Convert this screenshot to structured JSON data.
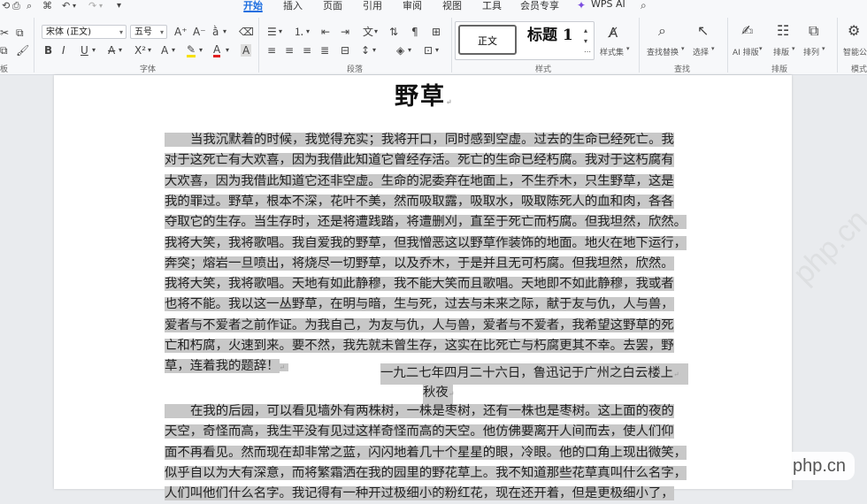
{
  "menu": {
    "tabs": [
      "开始",
      "插入",
      "页面",
      "引用",
      "审阅",
      "视图",
      "工具",
      "会员专享"
    ],
    "wps_ai": "WPS AI"
  },
  "font": {
    "family": "宋体 (正文)",
    "size": "五号",
    "group_label": "字体"
  },
  "paragraph": {
    "group_label": "段落"
  },
  "styles": {
    "normal": "正文",
    "heading1": "标题 1",
    "styleset": "样式集",
    "group_label": "样式"
  },
  "find": {
    "find_replace": "查找替换",
    "select": "选择",
    "group_label": "查找"
  },
  "arrange": {
    "ai_layout": "AI 排版",
    "layout": "排版",
    "arrange": "排列",
    "group_label": "排版"
  },
  "smart": {
    "smart_label": "智能公",
    "group_label": "模式"
  },
  "left_edge": {
    "board_label": "板"
  },
  "doc": {
    "title": "野草",
    "para1_lines": [
      "当我沉默着的时候，我觉得充实；我将开口，同时感到空虚。过去的生命已经死亡。我",
      "对于这死亡有大欢喜，因为我借此知道它曾经存活。死亡的生命已经朽腐。我对于这朽腐有",
      "大欢喜，因为我借此知道它还非空虚。生命的泥委弃在地面上，不生乔木，只生野草，这是",
      "我的罪过。野草，根本不深，花叶不美，然而吸取露，吸取水，吸取陈死人的血和肉，各各",
      "夺取它的生存。当生存时，还是将遭践踏，将遭删刈，直至于死亡而朽腐。但我坦然，欣然。",
      "我将大笑，我将歌唱。我自爱我的野草，但我憎恶这以野草作装饰的地面。地火在地下运行，",
      "奔突；熔岩一旦喷出，将烧尽一切野草，以及乔木，于是并且无可朽腐。但我坦然，欣然。",
      "我将大笑，我将歌唱。天地有如此静穆，我不能大笑而且歌唱。天地即不如此静穆，我或者",
      "也将不能。我以这一丛野草，在明与暗，生与死，过去与未来之际，献于友与仇，人与兽，",
      "爱者与不爱者之前作证。为我自己，为友与仇，人与兽，爱者与不爱者，我希望这野草的死",
      "亡和朽腐，火速到来。要不然，我先就未曾生存，这实在比死亡与朽腐更其不幸。去罢，野",
      "草，连着我的题辞！"
    ],
    "signature": "一九二七年四月二十六日，鲁迅记于广州之白云楼上",
    "subtitle": "秋夜",
    "para2_lines": [
      "在我的后园，可以看见墙外有两株树，一株是枣树，还有一株也是枣树。这上面的夜的",
      "天空，奇怪而高，我生平没有见过这样奇怪而高的天空。他仿佛要离开人间而去，使人们仰",
      "面不再看见。然而现在却非常之蓝，闪闪地着几十个星星的眼，冷眼。他的口角上现出微笑，",
      "似乎自以为大有深意，而将繁霜洒在我的园里的野花草上。我不知道那些花草真叫什么名字，",
      "人们叫他们什么名字。我记得有一种开过极细小的粉红花，现在还开着，但是更极细小了，"
    ]
  },
  "watermark": "php.cn"
}
